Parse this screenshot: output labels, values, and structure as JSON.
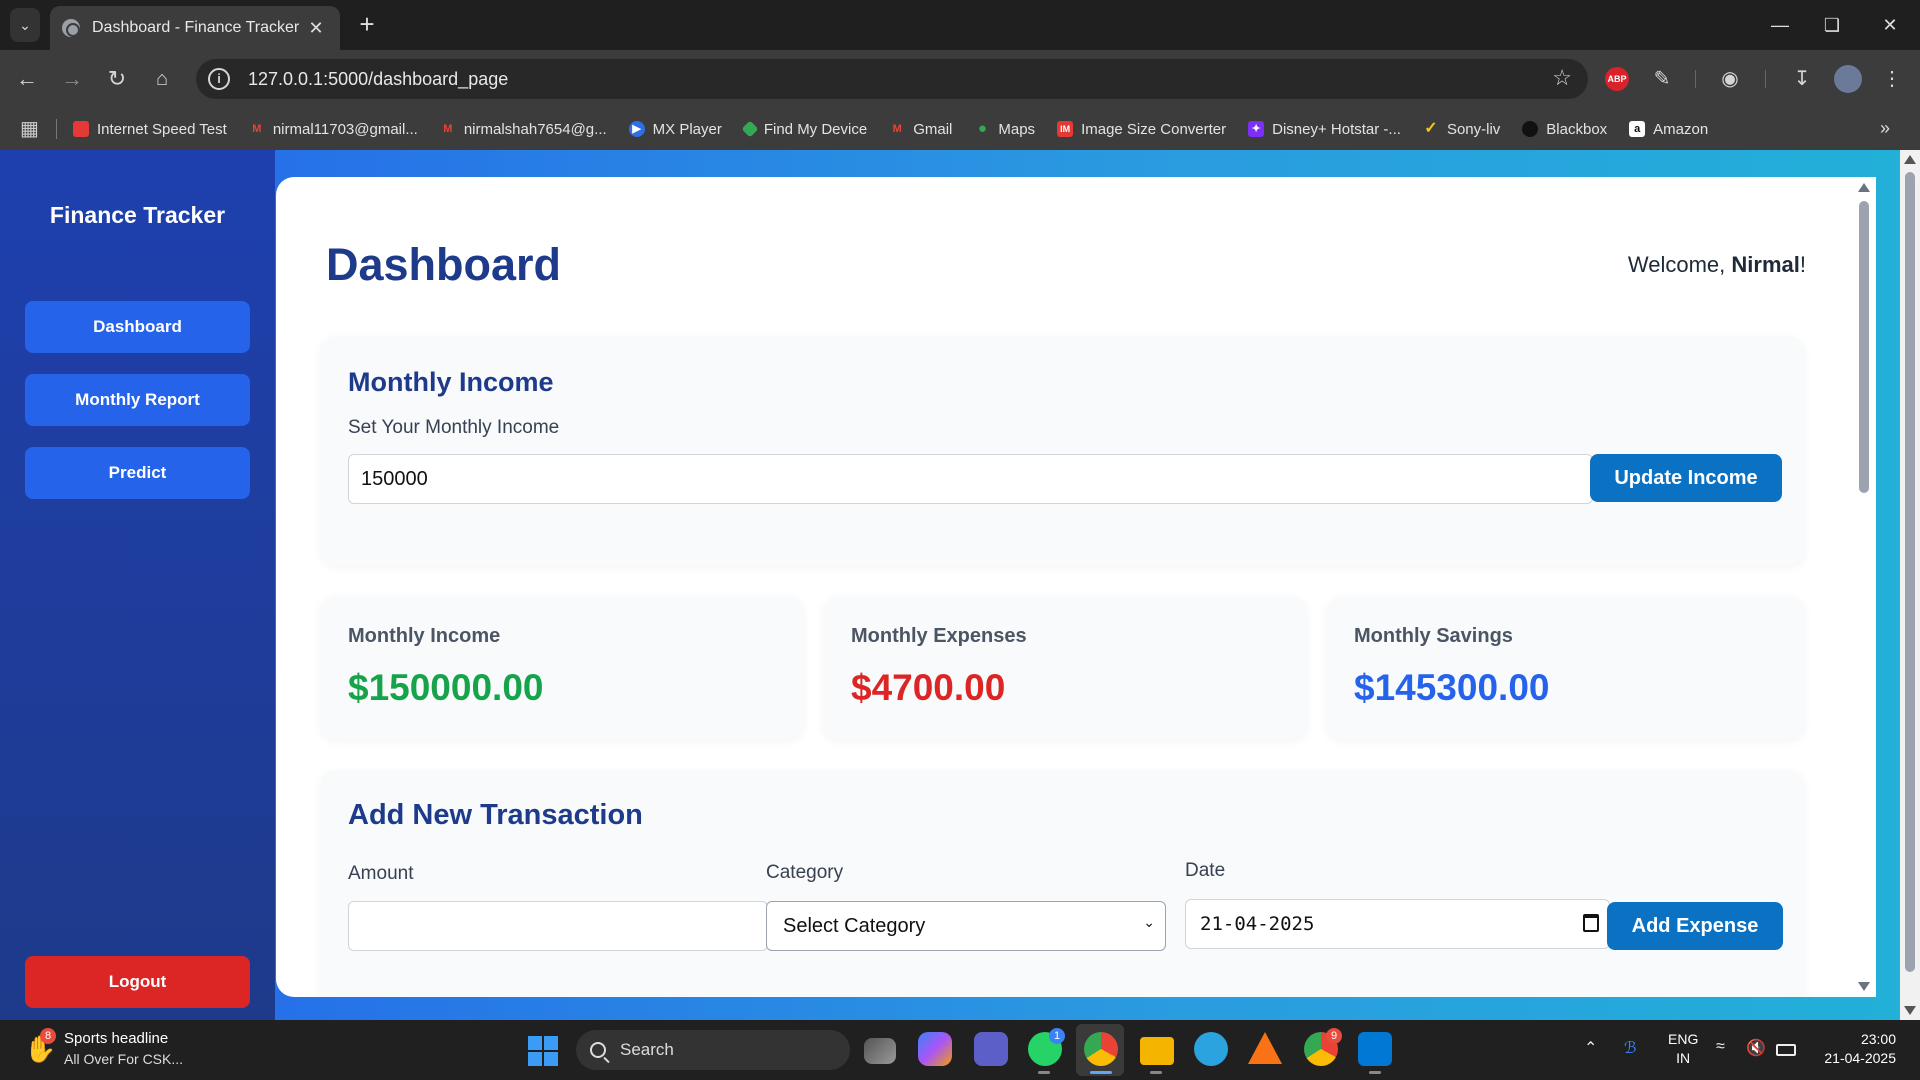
{
  "browser": {
    "tab_title": "Dashboard - Finance Tracker",
    "url": "127.0.0.1:5000/dashboard_page",
    "bookmarks": [
      {
        "label": "Internet Speed Test",
        "icon": "speedometer-icon",
        "color": "#e53935"
      },
      {
        "label": "nirmal11703@gmail...",
        "icon": "gmail-icon",
        "color": "#ea4335"
      },
      {
        "label": "nirmalshah7654@g...",
        "icon": "gmail-icon",
        "color": "#ea4335"
      },
      {
        "label": "MX Player",
        "icon": "mx-player-icon",
        "color": "#2f6fe4"
      },
      {
        "label": "Find My Device",
        "icon": "find-device-icon",
        "color": "#34a853"
      },
      {
        "label": "Gmail",
        "icon": "gmail-icon",
        "color": "#ea4335"
      },
      {
        "label": "Maps",
        "icon": "maps-icon",
        "color": "#34a853"
      },
      {
        "label": "Image Size Converter",
        "icon": "image-converter-icon",
        "color": "#e53935"
      },
      {
        "label": "Disney+ Hotstar -...",
        "icon": "hotstar-icon",
        "color": "#7b2ff7"
      },
      {
        "label": "Sony-liv",
        "icon": "sonyliv-icon",
        "color": "#f5c518"
      },
      {
        "label": "Blackbox",
        "icon": "blackbox-icon",
        "color": "#111111"
      },
      {
        "label": "Amazon",
        "icon": "amazon-icon",
        "color": "#ffffff"
      }
    ]
  },
  "sidebar": {
    "brand": "Finance Tracker",
    "items": [
      {
        "label": "Dashboard"
      },
      {
        "label": "Monthly Report"
      },
      {
        "label": "Predict"
      }
    ],
    "logout": "Logout"
  },
  "header": {
    "title": "Dashboard",
    "welcome_prefix": "Welcome, ",
    "user_name": "Nirmal",
    "welcome_suffix": "!"
  },
  "income_form": {
    "title": "Monthly Income",
    "label": "Set Your Monthly Income",
    "value": "150000",
    "button": "Update Income"
  },
  "stats": {
    "income": {
      "label": "Monthly Income",
      "value": "$150000.00",
      "color": "#16a34a"
    },
    "expenses": {
      "label": "Monthly Expenses",
      "value": "$4700.00",
      "color": "#dc2626"
    },
    "savings": {
      "label": "Monthly Savings",
      "value": "$145300.00",
      "color": "#2563eb"
    }
  },
  "transaction_form": {
    "title": "Add New Transaction",
    "amount_label": "Amount",
    "amount_value": "",
    "category_label": "Category",
    "category_selected": "Select Category",
    "date_label": "Date",
    "date_value": "21-04-2025",
    "button": "Add Expense"
  },
  "taskbar": {
    "news_badge": "8",
    "news_title": "Sports headline",
    "news_subtitle": "All Over For CSK...",
    "search_label": "Search",
    "whatsapp_badge": "1",
    "chrome2_badge": "9",
    "lang_line1": "ENG",
    "lang_line2": "IN",
    "time": "23:00",
    "date": "21-04-2025"
  }
}
